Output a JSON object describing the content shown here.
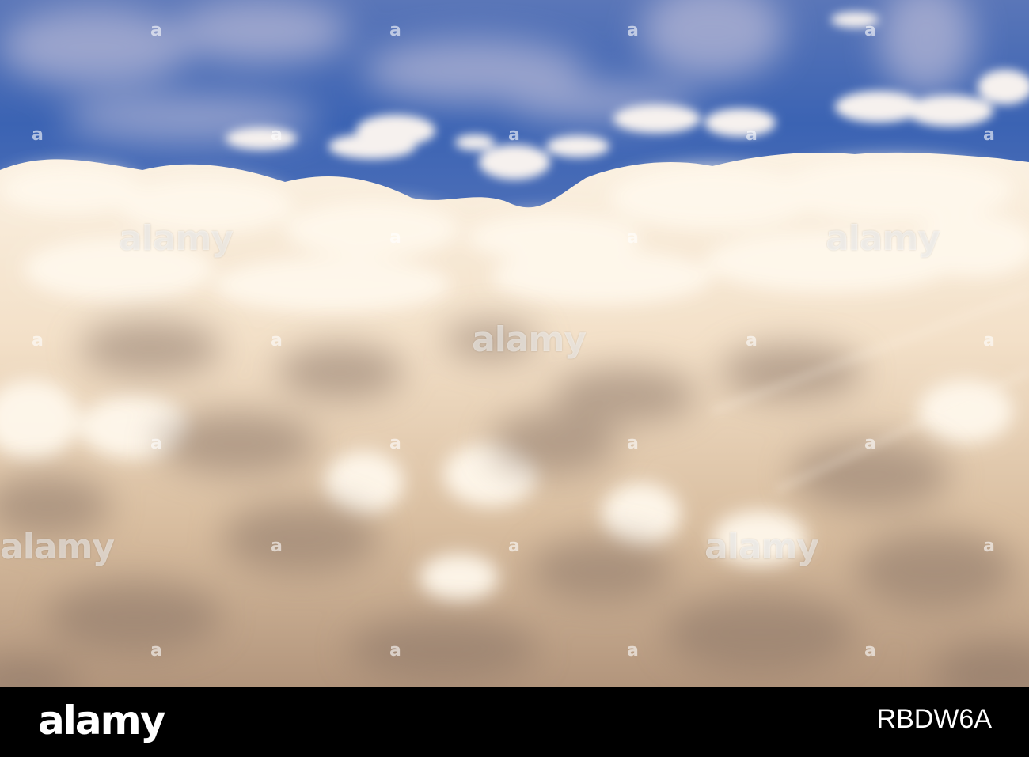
{
  "photo": {
    "subject": "clouds",
    "sky_color": "#3b63b3",
    "cloud_light_color": "#fff3df",
    "cloud_shadow_color": "#8f7b6c"
  },
  "watermark": {
    "brand": "alamy",
    "small_mark": "a"
  },
  "footer": {
    "logo": "alamy",
    "image_id": "RBDW6A",
    "background": "#000000"
  }
}
